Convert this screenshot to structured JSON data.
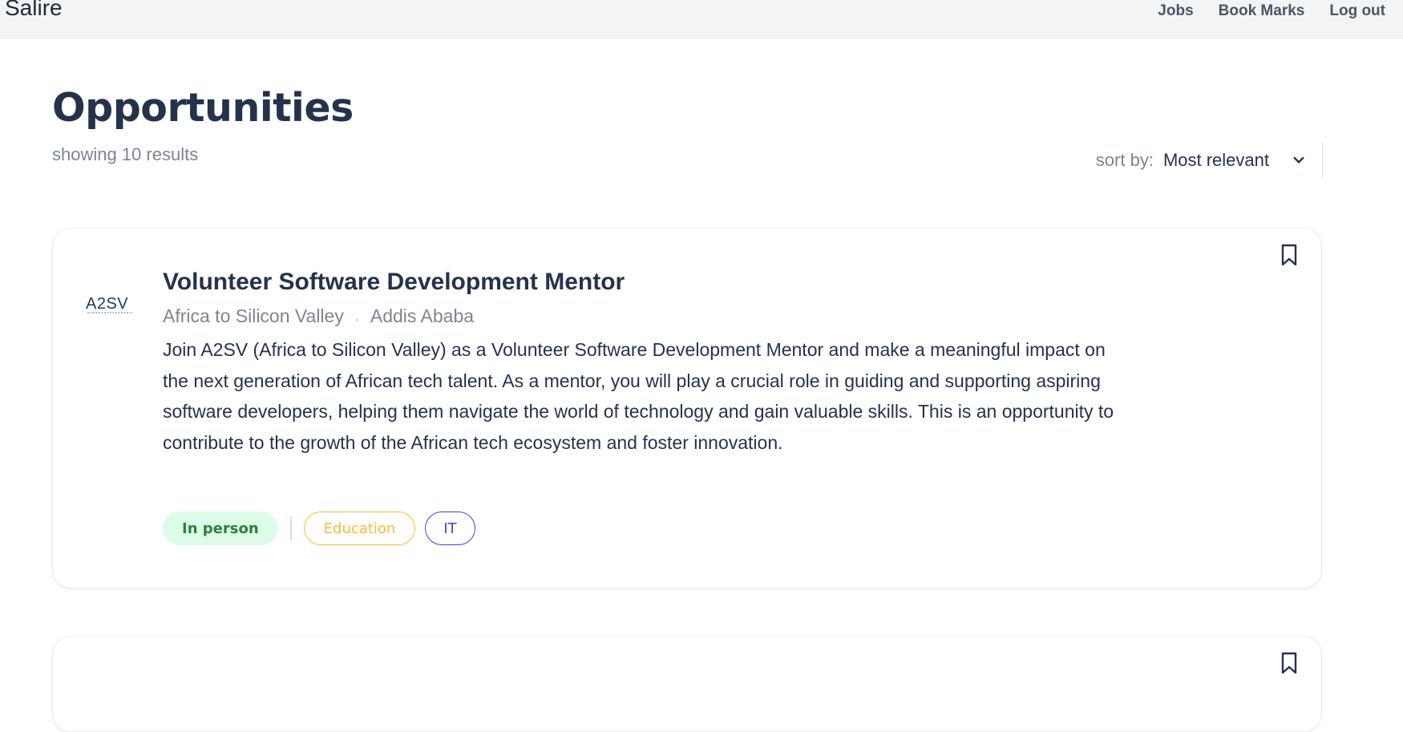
{
  "nav": {
    "brand": "Salire",
    "links": [
      "Jobs",
      "Book Marks",
      "Log out"
    ]
  },
  "header": {
    "title": "Opportunities",
    "results": "showing 10 results",
    "sort_label": "sort by:",
    "sort_value": "Most relevant"
  },
  "jobs": [
    {
      "title": "Volunteer Software Development Mentor",
      "company": "Africa to Silicon Valley",
      "location": "Addis Ababa",
      "logo_text": "A2SV",
      "description": "Join A2SV (Africa to Silicon Valley) as a Volunteer Software Development Mentor and make a meaningful impact on the next generation of African tech talent. As a mentor, you will play a crucial role in guiding and supporting aspiring software developers, helping them navigate the world of technology and gain valuable skills. This is an opportunity to contribute to the growth of the African tech ecosystem and foster innovation.",
      "tags": [
        "In person",
        "Education",
        "IT"
      ]
    }
  ],
  "colors": {
    "title": "#25324b",
    "muted": "#7c8493",
    "in_person_bg": "#dcfce7",
    "in_person_text": "#2e7d3d",
    "education": "#ffb836",
    "it": "#4640de"
  },
  "icons": [
    "bookmark-icon",
    "chevron-down-icon"
  ]
}
